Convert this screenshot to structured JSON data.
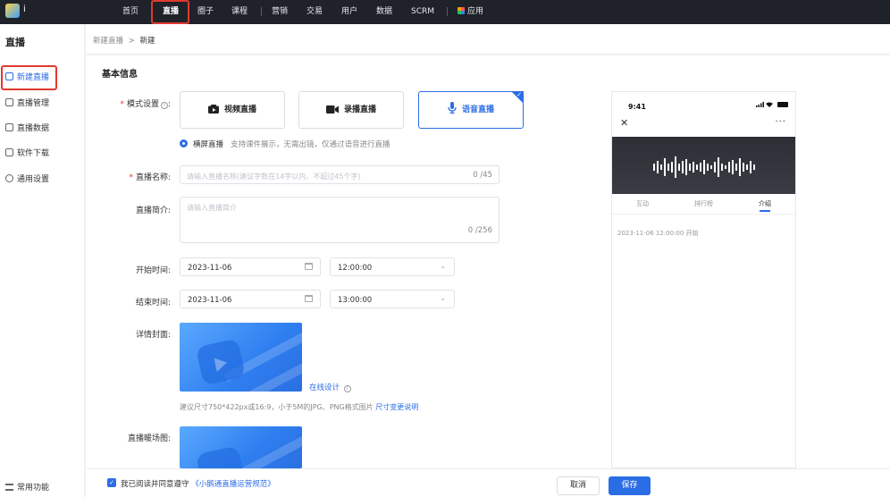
{
  "topnav": {
    "logo_text": "i",
    "items": [
      "首页",
      "直播",
      "圈子",
      "课程",
      "营销",
      "交易",
      "用户",
      "数据",
      "SCRM",
      "应用"
    ],
    "active_item": "直播"
  },
  "sidebar": {
    "title": "直播",
    "items": [
      "新建直播",
      "直播管理",
      "直播数据",
      "软件下载",
      "通用设置"
    ],
    "bottom": "常用功能"
  },
  "breadcrumb": {
    "parent": "新建直播",
    "separator": ">",
    "current": "新建"
  },
  "form": {
    "section_title": "基本信息",
    "mode": {
      "label": "模式设置",
      "options": [
        "视频直播",
        "录播直播",
        "语音直播"
      ],
      "selected": "语音直播",
      "radio_label": "横屏直播",
      "radio_desc": "支持课件展示，无需出镜，仅通过语音进行直播"
    },
    "name": {
      "label": "直播名称",
      "placeholder": "请输入直播名称(建议字数在14字以内，不超过45个字)",
      "count": "0 /45"
    },
    "intro": {
      "label": "直播简介",
      "placeholder": "请输入直播简介",
      "count": "0 /256"
    },
    "start": {
      "label": "开始时间",
      "date": "2023-11-06",
      "time": "12:00:00"
    },
    "end": {
      "label": "结束时间",
      "date": "2023-11-06",
      "time": "13:00:00"
    },
    "cover": {
      "label": "详情封面",
      "online_design": "在线设计",
      "hint": "建议尺寸750*422px或16:9，小于5M的JPG、PNG格式图片",
      "hint_link": "尺寸变更说明"
    },
    "warmup": {
      "label": "直播暖场图"
    }
  },
  "phone": {
    "time": "9:41",
    "close": "✕",
    "more": "···",
    "tabs": [
      "互动",
      "排行榜",
      "介绍"
    ],
    "active_tab": "介绍",
    "start_info": "2023-11-06 12:00:00 开始"
  },
  "bottombar": {
    "agree_text": "我已阅读并同意遵守",
    "agree_link": "《小鹅通直播运营规范》",
    "cancel": "取消",
    "save": "保存"
  },
  "colors": {
    "accent": "#2b6de5",
    "nav_bg": "#1f2229",
    "highlight": "#e03a2f"
  }
}
